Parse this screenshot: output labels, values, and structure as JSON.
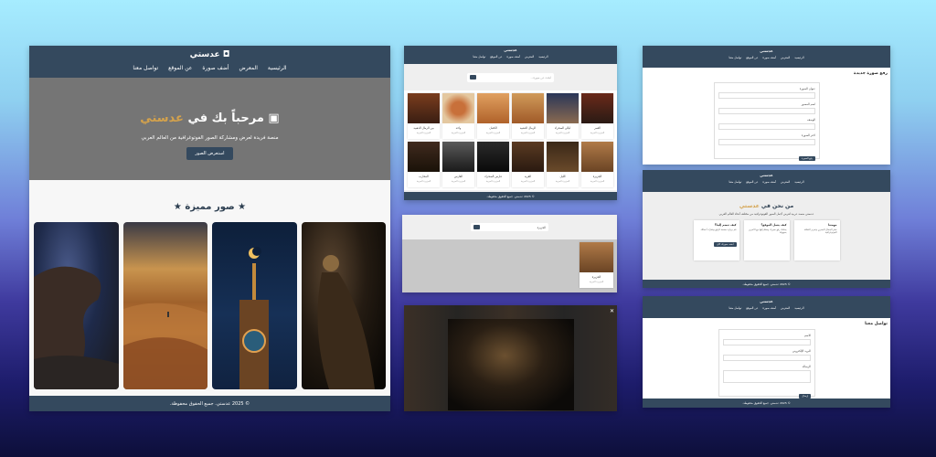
{
  "site": {
    "brand": "عدستي",
    "nav": [
      "الرئيسية",
      "المعرض",
      "أضف صورة",
      "عن الموقع",
      "تواصل معنا"
    ],
    "footer": "© 2025 عدستي. جميع الحقوق محفوظة."
  },
  "home": {
    "hero_title_prefix": "مرحباً بك في",
    "hero_title_accent": "عدستي",
    "hero_subtitle": "منصة فريدة لعرض ومشاركة الصور الفوتوغرافية من العالم العربي",
    "hero_button": "استعرض الصور",
    "featured_title": "صور مميزة",
    "camera_icon": "camera-icon",
    "star_icon": "star-icon"
  },
  "gallery": {
    "search_placeholder": "ابحث عن صورة...",
    "tiles": [
      {
        "caption": "بين الرمال الذهبية",
        "sub": "الجزيرة العربية"
      },
      {
        "caption": "واحة",
        "sub": "الجزيرة العربية"
      },
      {
        "caption": "الكثبان",
        "sub": "الجزيرة العربية"
      },
      {
        "caption": "الرمال الذهبية",
        "sub": "الجزيرة العربية"
      },
      {
        "caption": "ليالي الصحراء",
        "sub": "الجزيرة العربية"
      },
      {
        "caption": "القمر",
        "sub": "الجزيرة العربية"
      },
      {
        "caption": "المحارب",
        "sub": "الجزيرة العربية"
      },
      {
        "caption": "الفارس",
        "sub": "الجزيرة العربية"
      },
      {
        "caption": "فارس الصحراء",
        "sub": "الجزيرة العربية"
      },
      {
        "caption": "القرية",
        "sub": "الجزيرة العربية"
      },
      {
        "caption": "الليل",
        "sub": "الجزيرة العربية"
      },
      {
        "caption": "الجزيرة",
        "sub": "الجزيرة العربية"
      }
    ]
  },
  "search_result": {
    "query": "الجزيرة",
    "tile_caption": "الجزيرة",
    "tile_sub": "الجزيرة العربية"
  },
  "upload": {
    "title": "رفع صورة جديدة",
    "fields": [
      "عنوان الصورة",
      "اسم المصور",
      "الوصف",
      "اختر الصورة"
    ],
    "submit": "رفع الصورة"
  },
  "about": {
    "title_prefix": "من نحن في",
    "title_accent": "عدستي",
    "description": "عدستي منصة عربية لعرض أجمل الصور الفوتوغرافية من مختلف أنحاء العالم العربي",
    "cols": [
      {
        "title": "مهمتنا",
        "desc": "نشر الجمال البصري وتعزيز الثقافة الفوتوغرافية"
      },
      {
        "title": "كيف يعمل الموقع؟",
        "desc": "يمكنك رفع صورك ومشاركتها مع الآخرين بسهولة"
      },
      {
        "title": "كيف تنضم إلينا؟",
        "desc": "قم بزيارة صفحة الرفع وشارك أعمالك",
        "button": "أضف صورتك الآن"
      }
    ]
  },
  "contact": {
    "title": "تواصل معنا",
    "fields": [
      "الاسم",
      "البريد الإلكتروني",
      "الرسالة"
    ],
    "submit": "إرسال"
  },
  "colors": {
    "nav": "#34495e",
    "accent": "#d4a24c",
    "hero": "#757575"
  }
}
